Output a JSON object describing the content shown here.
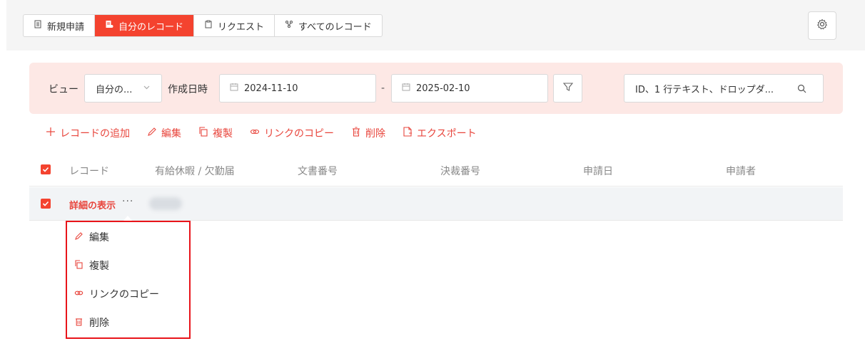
{
  "tabs": [
    {
      "label": "新規申請",
      "icon": "document-icon",
      "active": false
    },
    {
      "label": "自分のレコード",
      "icon": "my-records-icon",
      "active": true
    },
    {
      "label": "リクエスト",
      "icon": "clipboard-icon",
      "active": false
    },
    {
      "label": "すべてのレコード",
      "icon": "all-records-icon",
      "active": false
    }
  ],
  "settings": {
    "icon": "gear-icon"
  },
  "filters": {
    "view_label": "ビュー",
    "view_value": "自分の...",
    "date_label": "作成日時",
    "date_from": "2024-11-10",
    "date_separator": "-",
    "date_to": "2025-02-10",
    "search_placeholder": "ID、1 行テキスト、ドロップダ..."
  },
  "actions": [
    {
      "label": "レコードの追加",
      "icon": "plus-icon"
    },
    {
      "label": "編集",
      "icon": "pencil-icon"
    },
    {
      "label": "複製",
      "icon": "copy-icon"
    },
    {
      "label": "リンクのコピー",
      "icon": "link-icon"
    },
    {
      "label": "削除",
      "icon": "trash-icon"
    },
    {
      "label": "エクスポート",
      "icon": "export-icon"
    }
  ],
  "table": {
    "columns": [
      "レコード",
      "有給休暇 / 欠勤届",
      "文書番号",
      "決裁番号",
      "申請日",
      "申請者"
    ],
    "rows": [
      {
        "link_label": "詳細の表示",
        "more": "···"
      }
    ]
  },
  "row_menu": [
    {
      "label": "編集",
      "icon": "pencil-icon"
    },
    {
      "label": "複製",
      "icon": "copy-icon"
    },
    {
      "label": "リンクのコピー",
      "icon": "link-icon"
    },
    {
      "label": "削除",
      "icon": "trash-icon"
    }
  ],
  "colors": {
    "accent": "#f4432f",
    "accent_text": "#e8453c",
    "filter_bg": "#fde8e5",
    "highlight_border": "#e8141a"
  }
}
